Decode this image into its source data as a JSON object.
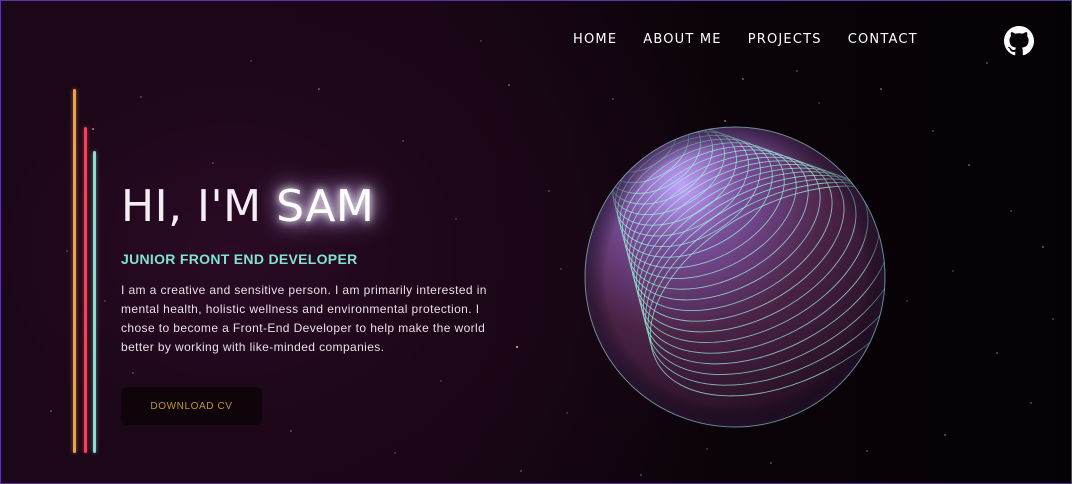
{
  "nav": {
    "items": [
      {
        "label": "HOME"
      },
      {
        "label": "ABOUT ME"
      },
      {
        "label": "PROJECTS"
      },
      {
        "label": "CONTACT"
      }
    ],
    "github_icon": "github-icon"
  },
  "hero": {
    "greeting": "HI, I'M",
    "name": "SAM",
    "subtitle": "JUNIOR FRONT END DEVELOPER",
    "bio": "I am a creative and sensitive person. I am primarily interested in mental health, holistic wellness and environmental protection. I chose to become a Front-End Developer to help make the world better by working with like-minded companies.",
    "cta_label": "DOWNLOAD CV"
  },
  "colors": {
    "background": "#1c0718",
    "accent_teal": "#7fe3cf",
    "accent_orange": "#f3a33a",
    "accent_red": "#e34a5c",
    "button_text": "#b99a2c",
    "frame_border": "#5a35a8"
  }
}
